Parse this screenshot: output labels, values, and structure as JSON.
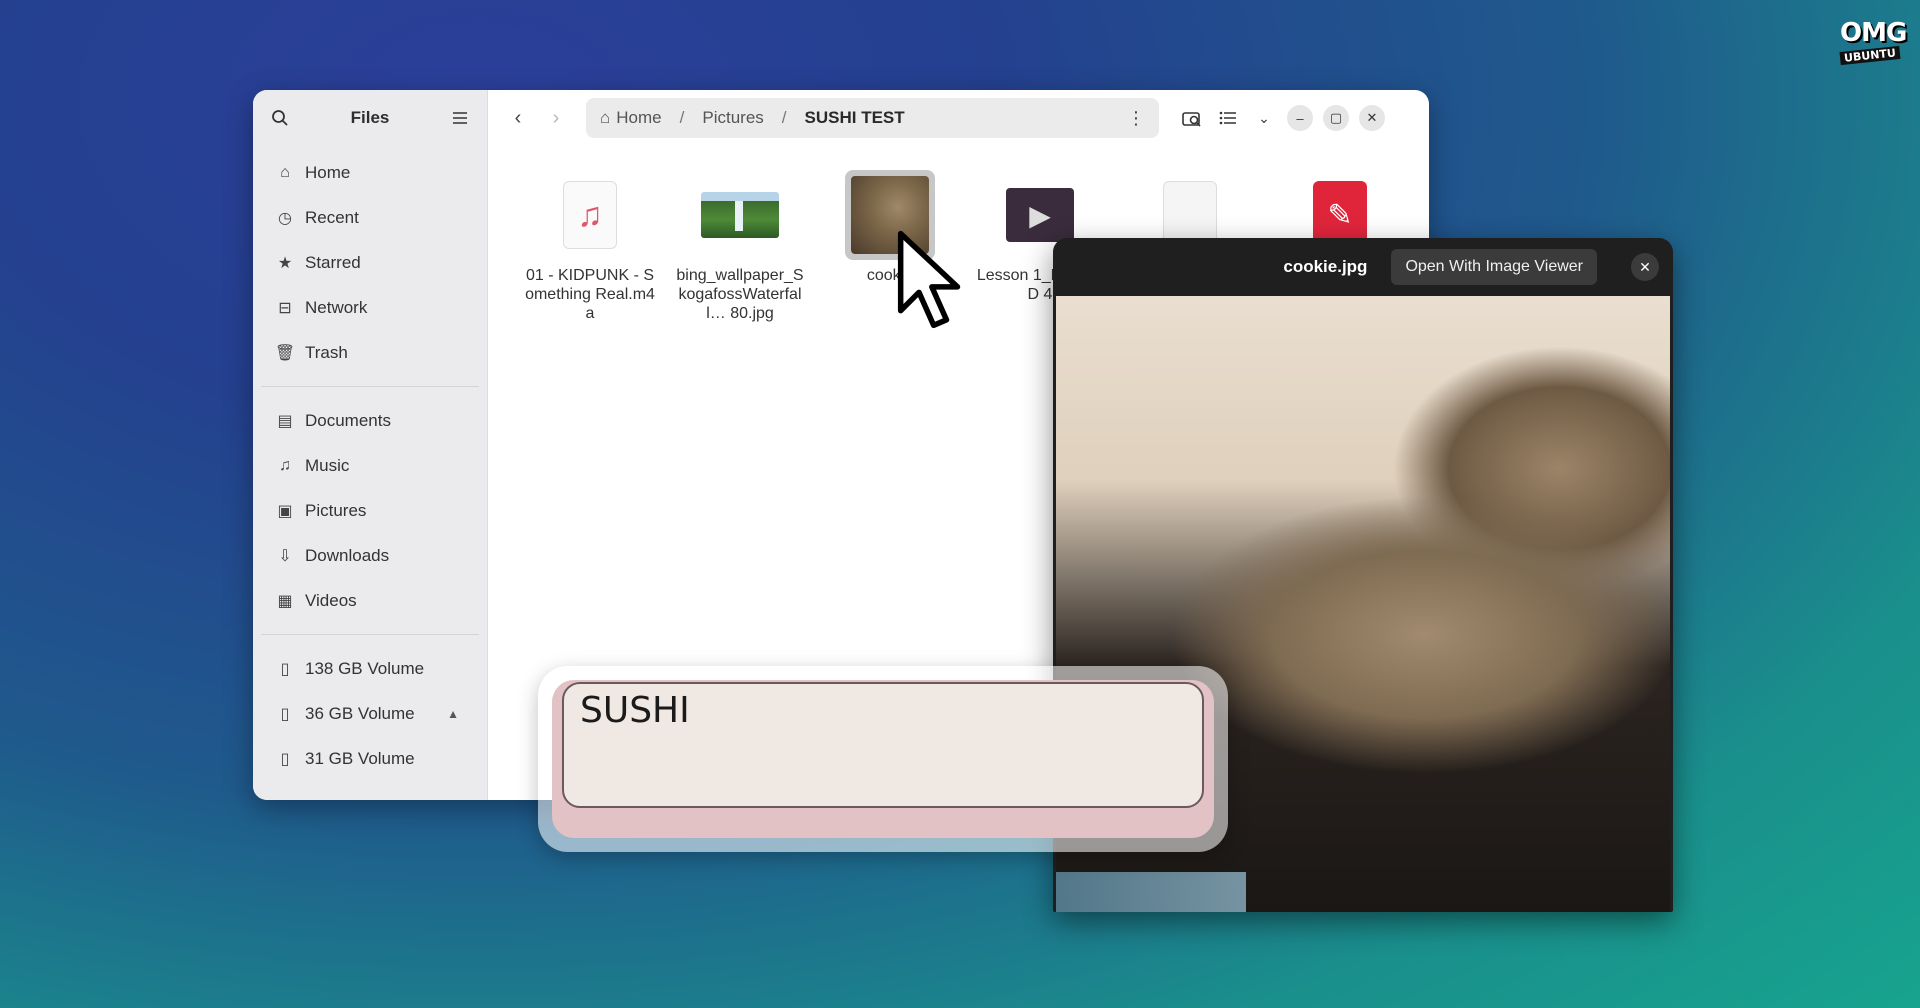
{
  "watermark": {
    "line1": "OMG",
    "line2": "UBUNTU"
  },
  "files_window": {
    "title": "Files",
    "sidebar": {
      "places": [
        {
          "label": "Home",
          "icon": "home-icon"
        },
        {
          "label": "Recent",
          "icon": "clock-icon"
        },
        {
          "label": "Starred",
          "icon": "star-icon"
        },
        {
          "label": "Network",
          "icon": "network-icon"
        },
        {
          "label": "Trash",
          "icon": "trash-icon"
        }
      ],
      "folders": [
        {
          "label": "Documents",
          "icon": "document-icon"
        },
        {
          "label": "Music",
          "icon": "music-icon"
        },
        {
          "label": "Pictures",
          "icon": "picture-icon"
        },
        {
          "label": "Downloads",
          "icon": "download-icon"
        },
        {
          "label": "Videos",
          "icon": "video-icon"
        }
      ],
      "volumes": [
        {
          "label": "138 GB Volume",
          "icon": "drive-icon"
        },
        {
          "label": "36 GB Volume",
          "icon": "drive-icon",
          "eject": "▲"
        },
        {
          "label": "31 GB Volume",
          "icon": "drive-icon"
        }
      ]
    },
    "path": {
      "home": "Home",
      "parent": "Pictures",
      "current": "SUSHI TEST"
    },
    "files": [
      {
        "name": "01 - KIDPUNK - Something Real.m4a",
        "type": "audio"
      },
      {
        "name": "bing_wallpaper_SkogafossWaterfall… 80.jpg",
        "type": "image"
      },
      {
        "name": "cookie",
        "type": "image",
        "selected": true
      },
      {
        "name": "Lesson 1_Light_2D 4",
        "type": "video"
      },
      {
        "name": "",
        "type": "text"
      },
      {
        "name": "",
        "type": "pdf"
      }
    ]
  },
  "preview": {
    "title": "cookie.jpg",
    "open_button": "Open With Image Viewer"
  },
  "key_overlay": {
    "label": "SUSHI"
  },
  "colors": {
    "pdf": "#e0253b",
    "music": "#e0566a",
    "preview_bg": "#1f1f1f"
  }
}
